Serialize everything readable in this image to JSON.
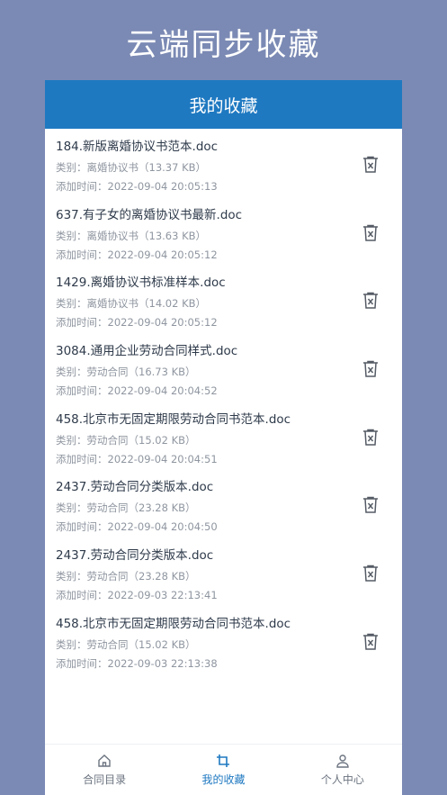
{
  "hero_title": "云端同步收藏",
  "card_title": "我的收藏",
  "items": [
    {
      "name": "184.新版离婚协议书范本.doc",
      "category": "类别：离婚协议书（13.37 KB）",
      "time": "添加时间：2022-09-04 20:05:13"
    },
    {
      "name": "637.有子女的离婚协议书最新.doc",
      "category": "类别：离婚协议书（13.63 KB）",
      "time": "添加时间：2022-09-04 20:05:12"
    },
    {
      "name": "1429.离婚协议书标准样本.doc",
      "category": "类别：离婚协议书（14.02 KB）",
      "time": "添加时间：2022-09-04 20:05:12"
    },
    {
      "name": "3084.通用企业劳动合同样式.doc",
      "category": "类别：劳动合同（16.73 KB）",
      "time": "添加时间：2022-09-04 20:04:52"
    },
    {
      "name": "458.北京市无固定期限劳动合同书范本.doc",
      "category": "类别：劳动合同（15.02 KB）",
      "time": "添加时间：2022-09-04 20:04:51"
    },
    {
      "name": "2437.劳动合同分类版本.doc",
      "category": "类别：劳动合同（23.28 KB）",
      "time": "添加时间：2022-09-04 20:04:50"
    },
    {
      "name": "2437.劳动合同分类版本.doc",
      "category": "类别：劳动合同（23.28 KB）",
      "time": "添加时间：2022-09-03 22:13:41"
    },
    {
      "name": "458.北京市无固定期限劳动合同书范本.doc",
      "category": "类别：劳动合同（15.02 KB）",
      "time": "添加时间：2022-09-03 22:13:38"
    }
  ],
  "tabs": [
    {
      "label": "合同目录",
      "icon": "home-icon"
    },
    {
      "label": "我的收藏",
      "icon": "crop-icon"
    },
    {
      "label": "个人中心",
      "icon": "user-icon"
    }
  ],
  "colors": {
    "accent": "#1f79c1",
    "background": "#7b8ab4"
  }
}
